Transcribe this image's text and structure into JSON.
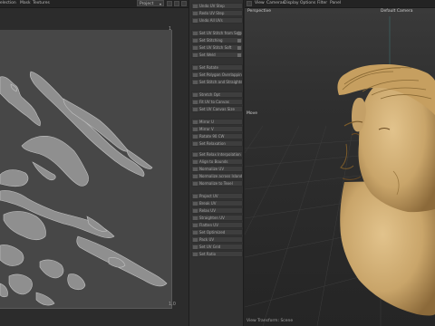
{
  "uv_editor": {
    "menu": [
      "Selection",
      "Mask",
      "Textures"
    ],
    "dropdown_value": "Project",
    "corner_top_right": "1",
    "corner_bottom_right": "1,0"
  },
  "uv_panel": {
    "commands": [
      "Undo UV Step",
      "Redo UV Step",
      "Undo All UVs",
      "Set UV Stitch from Selection",
      "Set Stitching",
      "Set UV Stitch Soft",
      "Set Weld",
      "Set Rotate",
      "Set Polygon Overlapping",
      "Set Stitch and Straighten",
      "Stretch Opt",
      "Fit UV to Canvas",
      "Set UV Canvas Size",
      "Mirror U",
      "Mirror V",
      "Rotate 90 CW",
      "Set Relaxation",
      "Set Relax Interpolation",
      "Align to Bounds",
      "Normalize UV",
      "Normalize across Islands",
      "Normalize to Texel",
      "Project UV",
      "Break UV",
      "Relax UV",
      "Straighten UV",
      "Flatten UV",
      "Set Optimized",
      "Pack UV",
      "Set UV Grid",
      "Set Ratio"
    ]
  },
  "viewport": {
    "menu": [
      "View",
      "Cameras",
      "Display",
      "Options",
      "Filter",
      "Panel"
    ],
    "view_name": "Perspective",
    "camera_name": "Default Camera",
    "tool_label": "Move",
    "status_text": "View Transform: Scene"
  },
  "colors": {
    "mesh": "#c9a56a",
    "uv_fill": "#8f8f8f",
    "canvas": "#474747"
  }
}
